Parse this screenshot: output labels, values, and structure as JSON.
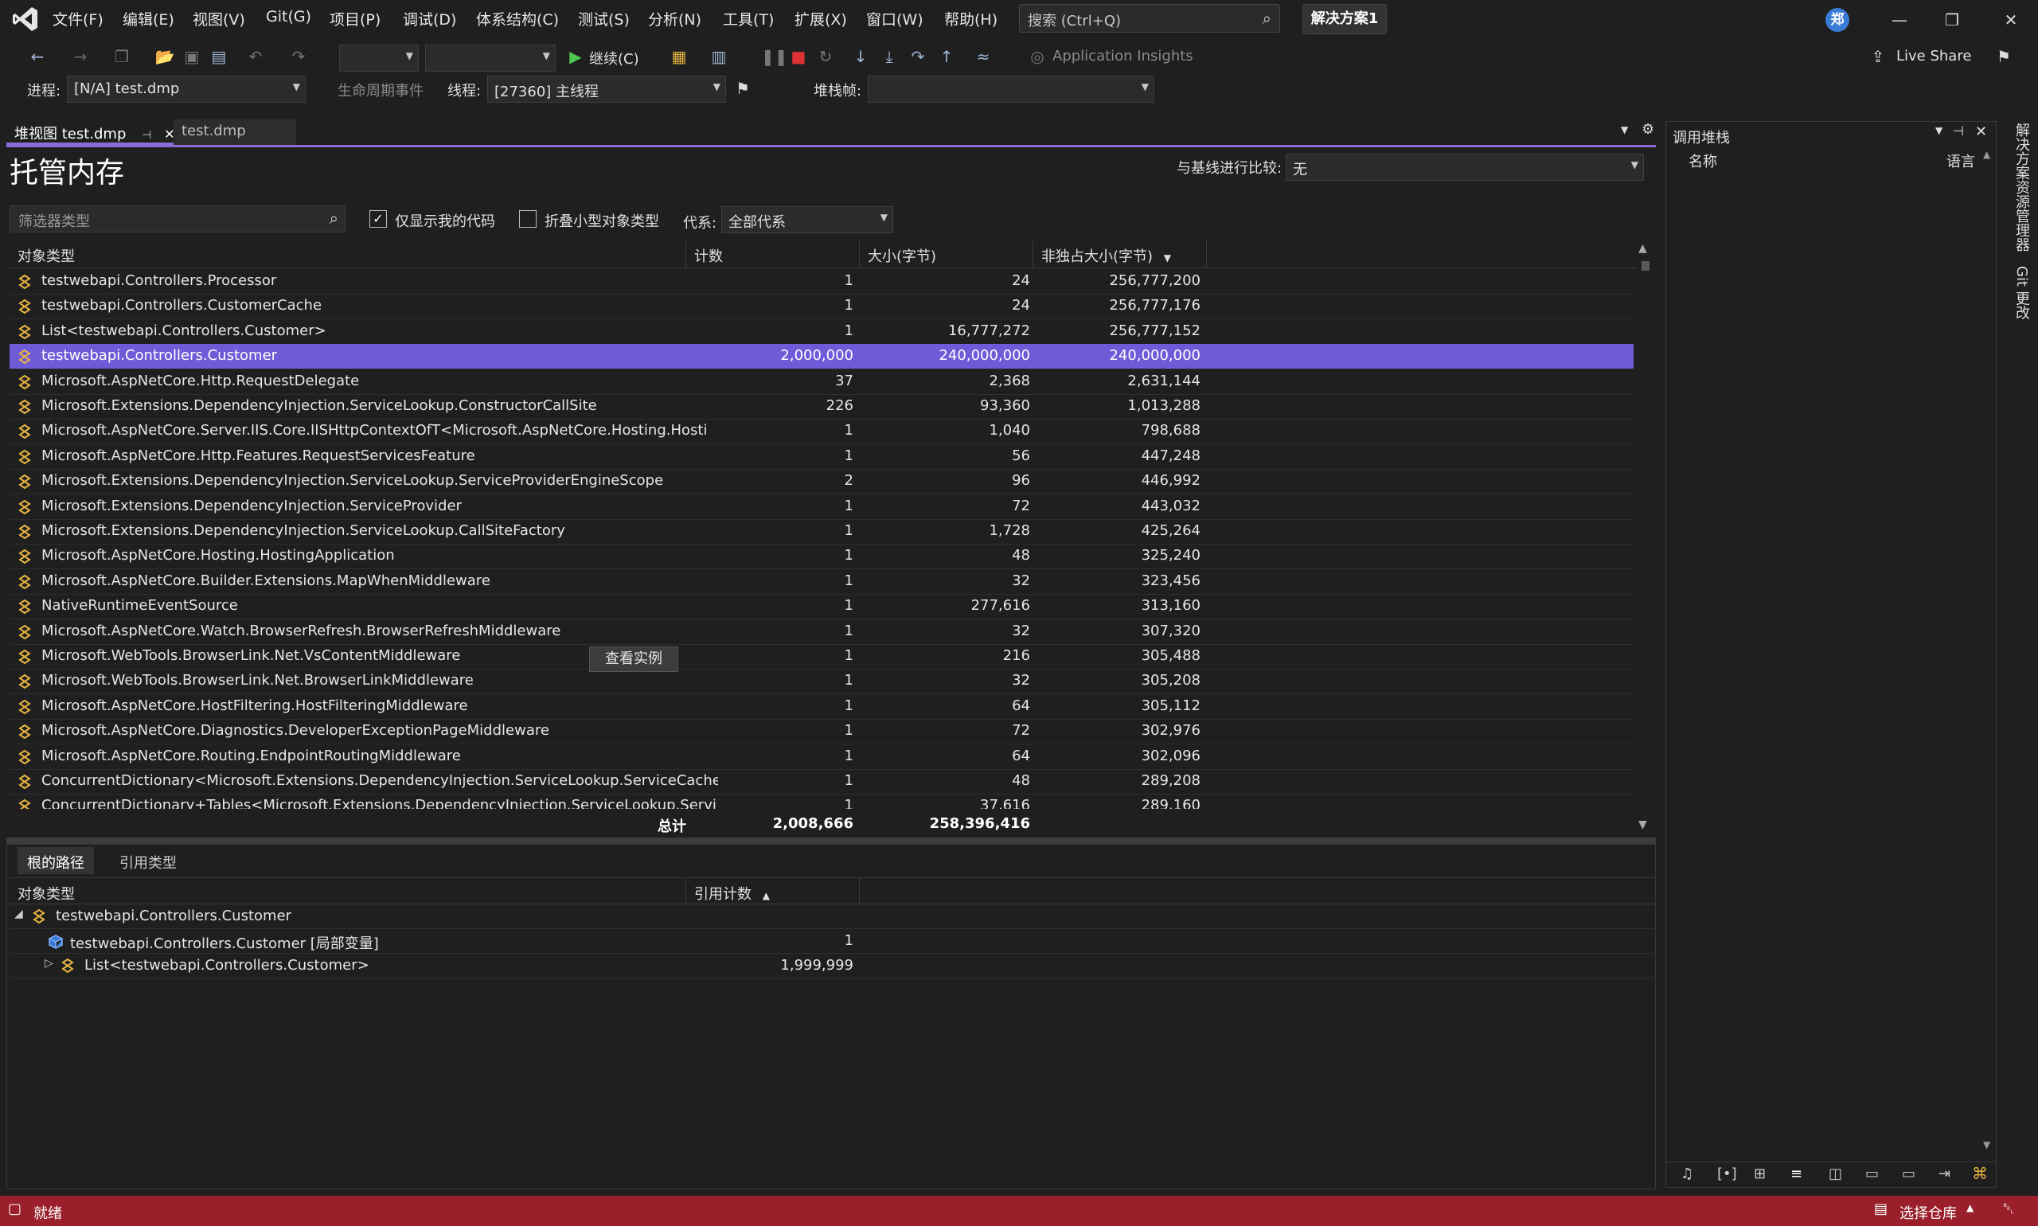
{
  "menu": {
    "items": [
      "文件(F)",
      "编辑(E)",
      "视图(V)",
      "Git(G)",
      "项目(P)",
      "调试(D)",
      "体系结构(C)",
      "测试(S)",
      "分析(N)",
      "工具(T)",
      "扩展(X)",
      "窗口(W)",
      "帮助(H)"
    ],
    "search_placeholder": "搜索 (Ctrl+Q)",
    "solution": "解决方案1",
    "avatar_initial": "郑",
    "live_share": "Live Share"
  },
  "toolbar": {
    "continue_label": "继续(C)",
    "app_insights": "Application Insights",
    "process_label": "进程:",
    "process_value": "[N/A] test.dmp",
    "lifecycle_label": "生命周期事件",
    "thread_label": "线程:",
    "thread_value": "[27360] 主线程",
    "stack_frame_label": "堆栈帧:"
  },
  "doc_tabs": {
    "active": "堆视图 test.dmp",
    "inactive": "test.dmp"
  },
  "heap": {
    "title": "托管内存",
    "baseline_label": "与基线进行比较:",
    "baseline_value": "无",
    "filter_placeholder": "筛选器类型",
    "just_my_code_label": "仅显示我的代码",
    "just_my_code_checked": true,
    "collapse_small_label": "折叠小型对象类型",
    "collapse_small_checked": false,
    "generation_label": "代系:",
    "generation_value": "全部代系",
    "columns": {
      "type": "对象类型",
      "count": "计数",
      "size": "大小(字节)",
      "retained": "非独占大小(字节)"
    },
    "rows": [
      {
        "name": "testwebapi.Controllers.Processor",
        "count": "1",
        "size": "24",
        "retained": "256,777,200"
      },
      {
        "name": "testwebapi.Controllers.CustomerCache",
        "count": "1",
        "size": "24",
        "retained": "256,777,176"
      },
      {
        "name": "List<testwebapi.Controllers.Customer>",
        "count": "1",
        "size": "16,777,272",
        "retained": "256,777,152"
      },
      {
        "name": "testwebapi.Controllers.Customer",
        "count": "2,000,000",
        "size": "240,000,000",
        "retained": "240,000,000"
      },
      {
        "name": "Microsoft.AspNetCore.Http.RequestDelegate",
        "count": "37",
        "size": "2,368",
        "retained": "2,631,144"
      },
      {
        "name": "Microsoft.Extensions.DependencyInjection.ServiceLookup.ConstructorCallSite",
        "count": "226",
        "size": "93,360",
        "retained": "1,013,288"
      },
      {
        "name": "Microsoft.AspNetCore.Server.IIS.Core.IISHttpContextOfT<Microsoft.AspNetCore.Hosting.Hosti",
        "count": "1",
        "size": "1,040",
        "retained": "798,688"
      },
      {
        "name": "Microsoft.AspNetCore.Http.Features.RequestServicesFeature",
        "count": "1",
        "size": "56",
        "retained": "447,248"
      },
      {
        "name": "Microsoft.Extensions.DependencyInjection.ServiceLookup.ServiceProviderEngineScope",
        "count": "2",
        "size": "96",
        "retained": "446,992"
      },
      {
        "name": "Microsoft.Extensions.DependencyInjection.ServiceProvider",
        "count": "1",
        "size": "72",
        "retained": "443,032"
      },
      {
        "name": "Microsoft.Extensions.DependencyInjection.ServiceLookup.CallSiteFactory",
        "count": "1",
        "size": "1,728",
        "retained": "425,264"
      },
      {
        "name": "Microsoft.AspNetCore.Hosting.HostingApplication",
        "count": "1",
        "size": "48",
        "retained": "325,240"
      },
      {
        "name": "Microsoft.AspNetCore.Builder.Extensions.MapWhenMiddleware",
        "count": "1",
        "size": "32",
        "retained": "323,456"
      },
      {
        "name": "NativeRuntimeEventSource",
        "count": "1",
        "size": "277,616",
        "retained": "313,160"
      },
      {
        "name": "Microsoft.AspNetCore.Watch.BrowserRefresh.BrowserRefreshMiddleware",
        "count": "1",
        "size": "32",
        "retained": "307,320"
      },
      {
        "name": "Microsoft.WebTools.BrowserLink.Net.VsContentMiddleware",
        "count": "1",
        "size": "216",
        "retained": "305,488"
      },
      {
        "name": "Microsoft.WebTools.BrowserLink.Net.BrowserLinkMiddleware",
        "count": "1",
        "size": "32",
        "retained": "305,208"
      },
      {
        "name": "Microsoft.AspNetCore.HostFiltering.HostFilteringMiddleware",
        "count": "1",
        "size": "64",
        "retained": "305,112"
      },
      {
        "name": "Microsoft.AspNetCore.Diagnostics.DeveloperExceptionPageMiddleware",
        "count": "1",
        "size": "72",
        "retained": "302,976"
      },
      {
        "name": "Microsoft.AspNetCore.Routing.EndpointRoutingMiddleware",
        "count": "1",
        "size": "64",
        "retained": "302,096"
      },
      {
        "name": "ConcurrentDictionary<Microsoft.Extensions.DependencyInjection.ServiceLookup.ServiceCache",
        "count": "1",
        "size": "48",
        "retained": "289,208"
      },
      {
        "name": "ConcurrentDictionary+Tables<Microsoft.Extensions.DependencyInjection.ServiceLookup.Servi",
        "count": "1",
        "size": "37,616",
        "retained": "289,160"
      }
    ],
    "selected_row_index": 3,
    "total_label": "总计",
    "total_count": "2,008,666",
    "total_size": "258,396,416",
    "view_instances": "查看实例"
  },
  "bottom": {
    "tab_paths": "根的路径",
    "tab_refs": "引用类型",
    "col_type": "对象类型",
    "col_refcount": "引用计数",
    "root": "testwebapi.Controllers.Customer",
    "child1": "testwebapi.Controllers.Customer [局部变量]",
    "child1_count": "1",
    "child2": "List<testwebapi.Controllers.Customer>",
    "child2_count": "1,999,999"
  },
  "call_stack": {
    "title": "调用堆栈",
    "col_name": "名称",
    "col_lang": "语言"
  },
  "side_tabs": {
    "solution_explorer": "解决方案资源管理器",
    "git_changes": "Git 更改"
  },
  "status": {
    "ready": "就绪",
    "select_repo": "选择仓库"
  },
  "colors": {
    "accent": "#8a6bd8",
    "selection": "#6f5bd8",
    "status_bar": "#9a1f2a"
  }
}
